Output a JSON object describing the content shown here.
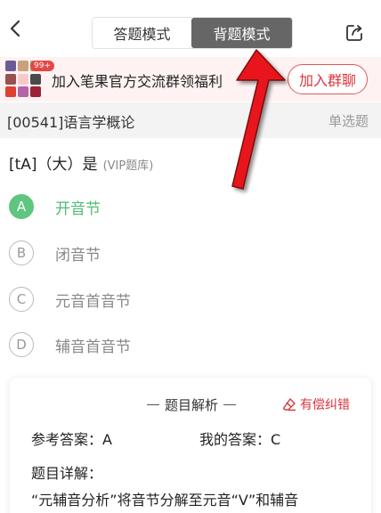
{
  "header": {
    "modes": [
      "答题模式",
      "背题模式"
    ],
    "active_mode": "背题模式"
  },
  "banner": {
    "badge": "99+",
    "text": "加入笔果官方交流群领福利",
    "button": "加入群聊"
  },
  "subject": {
    "name": "[00541]语言学概论",
    "type": "单选题"
  },
  "question": {
    "text": "[tA]（大）是",
    "tag": "(VIP题库)"
  },
  "options": [
    {
      "letter": "A",
      "text": "开音节",
      "correct": true
    },
    {
      "letter": "B",
      "text": "闭音节",
      "correct": false
    },
    {
      "letter": "C",
      "text": "元音首音节",
      "correct": false
    },
    {
      "letter": "D",
      "text": "辅音首音节",
      "correct": false
    }
  ],
  "analysis": {
    "title": "题目解析",
    "report": "有偿纠错",
    "ref_answer": "参考答案：A",
    "my_answer": "我的答案：C",
    "detail_title": "题目详解：",
    "detail_text": "“元辅音分析”将音节分解至元音“V”和辅音"
  },
  "colors": {
    "correct": "#4dbd72",
    "accent_red": "#d9363e",
    "arrow_red": "#e8191a",
    "active_tab": "#666666"
  }
}
